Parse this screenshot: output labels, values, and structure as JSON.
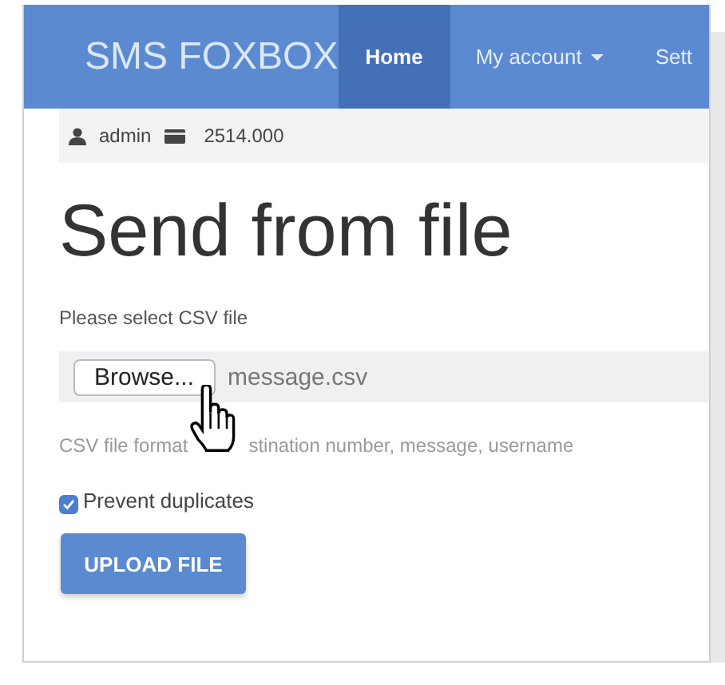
{
  "navbar": {
    "brand": "SMS FOXBOX",
    "items": [
      {
        "label": "Home",
        "selected": true,
        "dropdown": false
      },
      {
        "label": "My account",
        "selected": false,
        "dropdown": true
      },
      {
        "label": "Sett",
        "selected": false,
        "dropdown": false
      }
    ]
  },
  "user_bar": {
    "username": "admin",
    "balance": "2514.000"
  },
  "heading": "Send from file",
  "file_field": {
    "label": "Please select CSV file",
    "button": "Browse...",
    "value": "message.csv"
  },
  "help_text": [
    "CSV file format",
    "stination number, message, username"
  ],
  "checkbox": {
    "label": "Prevent duplicates",
    "checked": true
  },
  "submit": "UPLOAD FILE"
}
